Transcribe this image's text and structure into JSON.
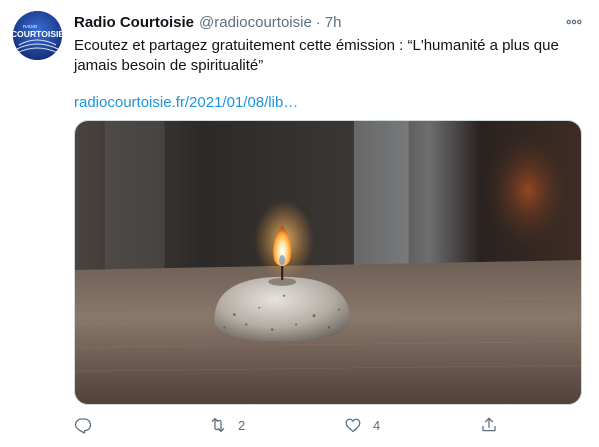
{
  "tweet": {
    "display_name": "Radio Courtoisie",
    "handle": "@radiocourtoisie",
    "separator": "·",
    "time": "7h",
    "text": "Ecoutez et partagez gratuitement cette émission : “L'humanité a plus que jamais besoin de spiritualité”",
    "link": "radiocourtoisie.fr/2021/01/08/lib…",
    "avatar_logo_text": "COURTOISIE",
    "avatar_logo_small": "RADIO",
    "media_icon": "candle-photo"
  },
  "actions": {
    "reply_icon": "reply-icon",
    "retweet_icon": "retweet-icon",
    "retweet_count": "2",
    "like_icon": "heart-icon",
    "like_count": "4",
    "share_icon": "share-icon"
  },
  "colors": {
    "link": "#1b95e0",
    "secondary_text": "#5b7083",
    "avatar_bg": "#1b3a8c"
  }
}
